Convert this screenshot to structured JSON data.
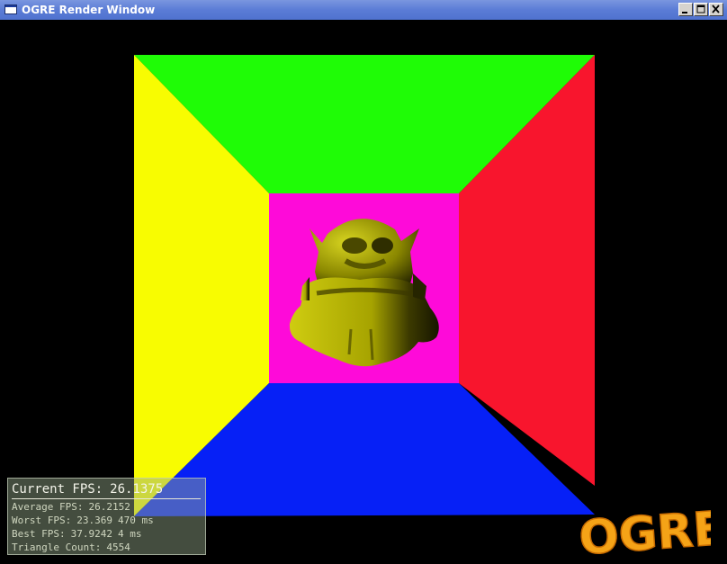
{
  "window": {
    "title": "OGRE Render Window"
  },
  "scene": {
    "colors": {
      "ceiling": "#1ffc06",
      "left_wall": "#f8fc01",
      "right_wall": "#f8152d",
      "floor": "#0620f6",
      "back_wall": "#fe0ad9",
      "background": "#000000",
      "model": "#b8b400"
    },
    "model_icon": "ogre-head"
  },
  "stats": {
    "current_label": "Current FPS:",
    "current_value": "26.1375",
    "average_label": "Average FPS:",
    "average_value": "26.2152",
    "worst_label": "Worst FPS:",
    "worst_value": "23.369",
    "worst_time": "470 ms",
    "best_label": "Best FPS:",
    "best_value": "37.9242",
    "best_time": "4 ms",
    "triangles_label": "Triangle Count:",
    "triangles_value": "4554"
  },
  "logo": {
    "text": "OGRE"
  }
}
